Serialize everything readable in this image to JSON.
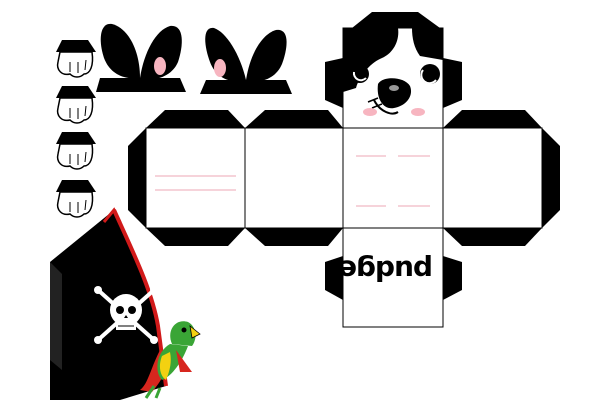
{
  "template": {
    "name_text": "pudge"
  },
  "colors": {
    "ink": "#000000",
    "paper": "#ffffff",
    "fold_line": "#e88a9b",
    "ear_blush": "#f7b5c0",
    "hat_trim": "#d11a1a",
    "parrot_green": "#3aa536",
    "parrot_yellow": "#f3d111",
    "parrot_red": "#d7261e"
  },
  "icons": {
    "paws": "paw-icon",
    "ears": "ear-icon",
    "face": "dog-face-icon",
    "hat": "pirate-hat-icon",
    "skull": "skull-crossbones-icon",
    "parrot": "parrot-icon"
  }
}
